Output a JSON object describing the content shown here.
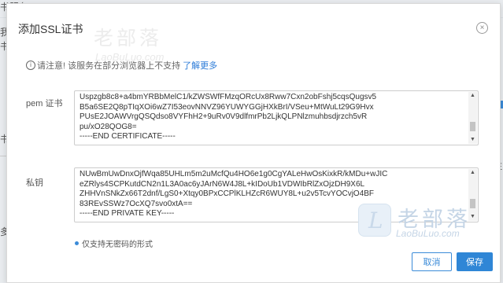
{
  "background": {
    "title": "书服务",
    "frag1": "我",
    "frag2": "书",
    "frag3": "书",
    "frag4": "多",
    "frag5": "E"
  },
  "modal": {
    "title": "添加SSL证书",
    "close_glyph": "×",
    "notice_text": "请注意! 该服务在部分浏览器上不支持",
    "notice_link": "了解更多",
    "info_glyph": "i"
  },
  "pem": {
    "label": "pem 证书",
    "lines": [
      "Uspzgb8c8+a4bmYRBbMelC1/kZWSWfFMzqORcUx8Rww7Cxn2obFshj5cqsQugsv5",
      "B5a6SE2Q8pTIqXOi6wZ7I53eovNNVZ96YUWYGGjHXkBrI/VSeu+MtWuLt29G9Hvx",
      "PUsE2JOAWVrgQSQdso8VYFhH2+9uRv0V9dlfmrPb2LjkQLPNlzmuhbsdjrzch5vR",
      "pu/xO28QOG8=",
      "-----END CERTIFICATE-----"
    ]
  },
  "private_key": {
    "label": "私钥",
    "lines": [
      "NUwBmUwDnxOjfWqa85UHLm5m2uMcfQu4HO6e1g0CgYALeHwOsKixkR/kMDu+wJIC",
      "eZRlys4SCPKutdCN2n1L3A0ac6yJArN6W4J8L+kIDoUb1VDWIbRlZxOjzDH9X6L",
      "ZHHVnSNkZx66T2dnf/LgS0+Xtqy0BPxCCPlKLHZcR6WUY8L+u2v5TcvYOCvjO4BF",
      "83REvSSWz7OcXQ7svo0xtA==",
      "-----END PRIVATE KEY-----"
    ]
  },
  "hint": "仅支持无密码的形式",
  "buttons": {
    "cancel": "取消",
    "save": "保存"
  },
  "scroll_glyphs": {
    "up": "▲",
    "down": "▼"
  },
  "watermark": {
    "cn": "老部落",
    "en": "LaoBuLuo.com",
    "logo_letter": "L"
  },
  "colors": {
    "accent": "#2f86d6",
    "link": "#2b7bd8"
  }
}
